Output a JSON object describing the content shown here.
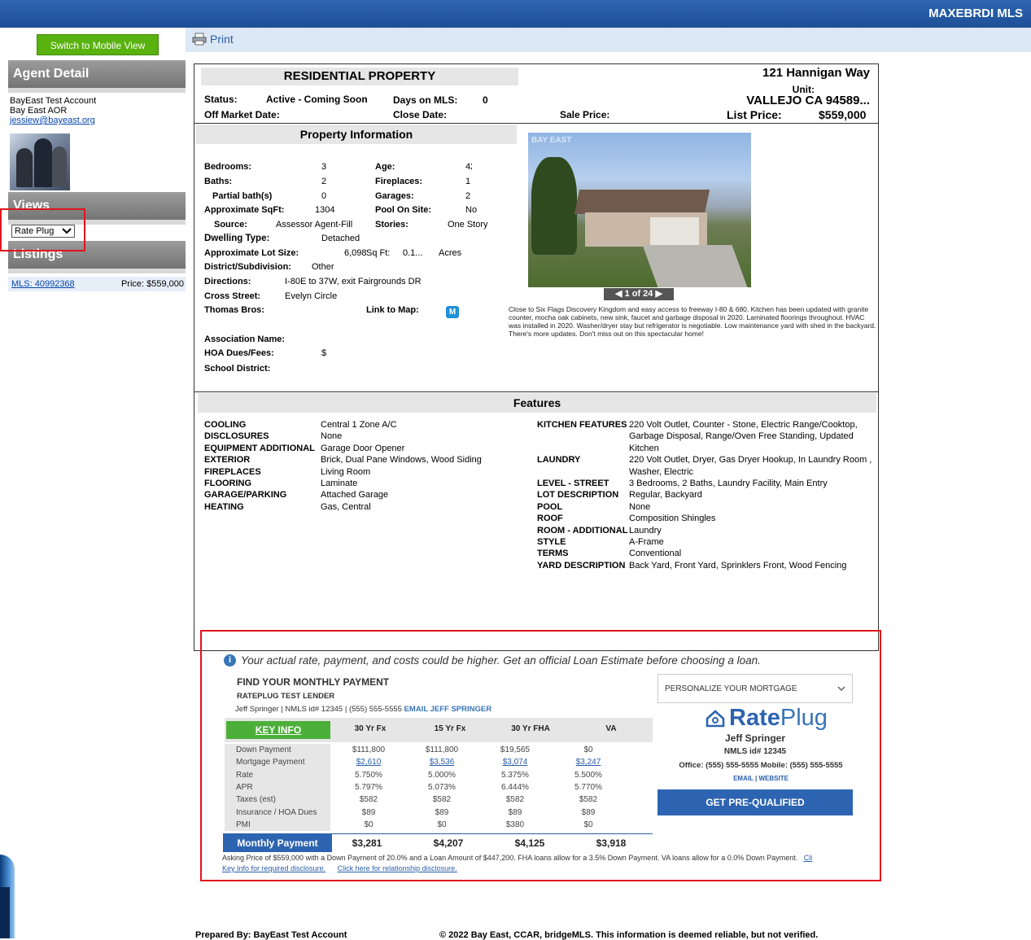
{
  "header": {
    "mls_name": "MAXEBRDI MLS"
  },
  "toolbar": {
    "print_label": "Print"
  },
  "sidebar": {
    "mobile_button": "Switch to Mobile View",
    "agent_heading": "Agent Detail",
    "agent_name": "BayEast Test Account",
    "agent_org": "Bay East AOR",
    "agent_email": "jessiew@bayeast.org",
    "views_heading": "Views",
    "views_selected": "Rate Plug",
    "listings_heading": "Listings",
    "listing_mls": "MLS: 40992368",
    "listing_price": "Price: $559,000"
  },
  "property": {
    "type_title": "RESIDENTIAL PROPERTY",
    "street": "121 Hannigan Way",
    "unit_label": "Unit:",
    "city_zip": "VALLEJO CA  94589...",
    "status_label": "Status:",
    "status_value": "Active - Coming Soon",
    "dom_label": "Days on MLS:",
    "dom_value": "0",
    "off_market_label": "Off Market Date:",
    "close_date_label": "Close Date:",
    "sale_price_label": "Sale Price:",
    "list_price_label": "List Price:",
    "list_price_value": "$559,000"
  },
  "info": {
    "section_title": "Property Information",
    "bedrooms_label": "Bedrooms:",
    "bedrooms": "3",
    "age_label": "Age:",
    "age": "42",
    "baths_label": "Baths:",
    "baths": "2",
    "fireplaces_label": "Fireplaces:",
    "fireplaces": "1",
    "partial_label": "Partial bath(s)",
    "partial": "0",
    "garages_label": "Garages:",
    "garages": "2",
    "sqft_label": "Approximate SqFt:",
    "sqft": "1304",
    "pool_label": "Pool On Site:",
    "pool": "No",
    "source_label": "Source:",
    "source": "Assessor Agent-Fill",
    "stories_label": "Stories:",
    "stories": "One Story",
    "dwelling_label": "Dwelling Type:",
    "dwelling": "Detached",
    "lot_label": "Approximate Lot Size:",
    "lot_sqft": "6,098",
    "lot_sqft_unit": "Sq Ft:",
    "lot_acres": "0.1...",
    "lot_acres_unit": "Acres",
    "district_label": "District/Subdivision:",
    "district": "Other",
    "directions_label": "Directions:",
    "directions": "I-80E to 37W, exit Fairgrounds DR",
    "cross_label": "Cross Street:",
    "cross": "Evelyn Circle",
    "thomas_label": "Thomas Bros:",
    "map_label": "Link to Map:",
    "map_icon": "M",
    "assoc_label": "Association Name:",
    "hoa_label": "HOA Dues/Fees:",
    "hoa": "$",
    "school_label": "School District:",
    "photo_counter": "◀ 1 of 24 ▶",
    "photo_logo": "BAY EAST",
    "description": "Close to Six Flags Discovery Kingdom and easy access to freeway I-80 & 680. Kitchen has been updated with granite counter, mocha oak cabinets, new sink, faucet and garbage disposal in 2020. Laminated floorings throughout. HVAC was installed in 2020. Washer/dryer stay but refrigerator is negotiable. Low maintenance yard with shed in the backyard. There's more updates. Don't miss out on this spectacular home!"
  },
  "features": {
    "section_title": "Features",
    "left": [
      {
        "label": "COOLING",
        "value": "Central 1 Zone A/C"
      },
      {
        "label": "DISCLOSURES",
        "value": "None"
      },
      {
        "label": "EQUIPMENT ADDITIONAL",
        "value": "Garage Door Opener"
      },
      {
        "label": "EXTERIOR",
        "value": "Brick, Dual Pane Windows, Wood Siding"
      },
      {
        "label": "FIREPLACES",
        "value": "Living Room"
      },
      {
        "label": "FLOORING",
        "value": "Laminate"
      },
      {
        "label": "GARAGE/PARKING",
        "value": "Attached Garage"
      },
      {
        "label": "HEATING",
        "value": "Gas, Central"
      }
    ],
    "right": [
      {
        "label": "KITCHEN FEATURES",
        "value": "220 Volt Outlet, Counter - Stone, Electric Range/Cooktop, Garbage Disposal, Range/Oven Free Standing, Updated Kitchen"
      },
      {
        "label": "LAUNDRY",
        "value": "220 Volt Outlet, Dryer, Gas Dryer Hookup, In Laundry Room , Washer, Electric"
      },
      {
        "label": "LEVEL - STREET",
        "value": "3 Bedrooms, 2 Baths, Laundry Facility, Main Entry"
      },
      {
        "label": "LOT DESCRIPTION",
        "value": "Regular, Backyard"
      },
      {
        "label": "POOL",
        "value": "None"
      },
      {
        "label": "ROOF",
        "value": "Composition Shingles"
      },
      {
        "label": "ROOM - ADDITIONAL",
        "value": "Laundry"
      },
      {
        "label": "STYLE",
        "value": "A-Frame"
      },
      {
        "label": "TERMS",
        "value": "Conventional"
      },
      {
        "label": "YARD DESCRIPTION",
        "value": "Back Yard, Front Yard, Sprinklers Front, Wood Fencing"
      }
    ]
  },
  "rateplug": {
    "notice": "Your actual rate, payment, and costs could be higher. Get an official Loan Estimate before choosing a loan.",
    "find_title": "FIND YOUR MONTHLY PAYMENT",
    "lender": "RATEPLUG TEST LENDER",
    "contact": "Jeff Springer | NMLS id# 12345 | (555) 555-5555",
    "contact_email": "EMAIL JEFF SPRINGER",
    "key_info": "KEY INFO",
    "columns": [
      "30 Yr Fx",
      "15 Yr Fx",
      "30 Yr FHA",
      "VA"
    ],
    "rows": [
      {
        "label": "Down Payment",
        "values": [
          "$111,800",
          "$111,800",
          "$19,565",
          "$0"
        ]
      },
      {
        "label": "Mortgage Payment",
        "values": [
          "$2,610",
          "$3,536",
          "$3,074",
          "$3,247"
        ]
      },
      {
        "label": "Rate",
        "values": [
          "5.750%",
          "5.000%",
          "5.375%",
          "5.500%"
        ]
      },
      {
        "label": "APR",
        "values": [
          "5.797%",
          "5.073%",
          "6.444%",
          "5.770%"
        ]
      },
      {
        "label": "Taxes (est)",
        "values": [
          "$582",
          "$582",
          "$582",
          "$582"
        ]
      },
      {
        "label": "Insurance / HOA Dues",
        "values": [
          "$89",
          "$89",
          "$89",
          "$89"
        ]
      },
      {
        "label": "PMI",
        "values": [
          "$0",
          "$0",
          "$380",
          "$0"
        ]
      }
    ],
    "monthly_label": "Monthly Payment",
    "monthly_values": [
      "$3,281",
      "$4,207",
      "$4,125",
      "$3,918"
    ],
    "asking_text": "Asking Price of $559,000 with a Down Payment of 20.0% and a Loan Amount of $447,200. FHA loans allow for a 3.5% Down Payment. VA loans allow for a 0.0% Down Payment.",
    "asking_link": "Cli",
    "disclosure_1": "Key Info for required disclosure.",
    "disclosure_2": "Click here for relationship disclosure.",
    "personalize": "PERSONALIZE YOUR MORTGAGE",
    "personalize_icon": "chevron-down-icon",
    "logo_rate": "Rate",
    "logo_plug": "Plug",
    "ra_name": "Jeff Springer",
    "ra_nmls": "NMLS id# 12345",
    "ra_phone": "Office: (555) 555-5555 Mobile: (555) 555-5555",
    "ra_links": "EMAIL | WEBSITE",
    "prequal": "GET PRE-QUALIFIED"
  },
  "footer": {
    "prepared": "Prepared By:   BayEast Test Account",
    "copyright": "© 2022 Bay East, CCAR, bridgeMLS. This information is deemed reliable, but not verified."
  },
  "colors": {
    "header_blue": "#1d4f96",
    "green": "#59b20e",
    "rateplug_blue": "#2d64b1",
    "highlight_red": "#e0141e"
  }
}
